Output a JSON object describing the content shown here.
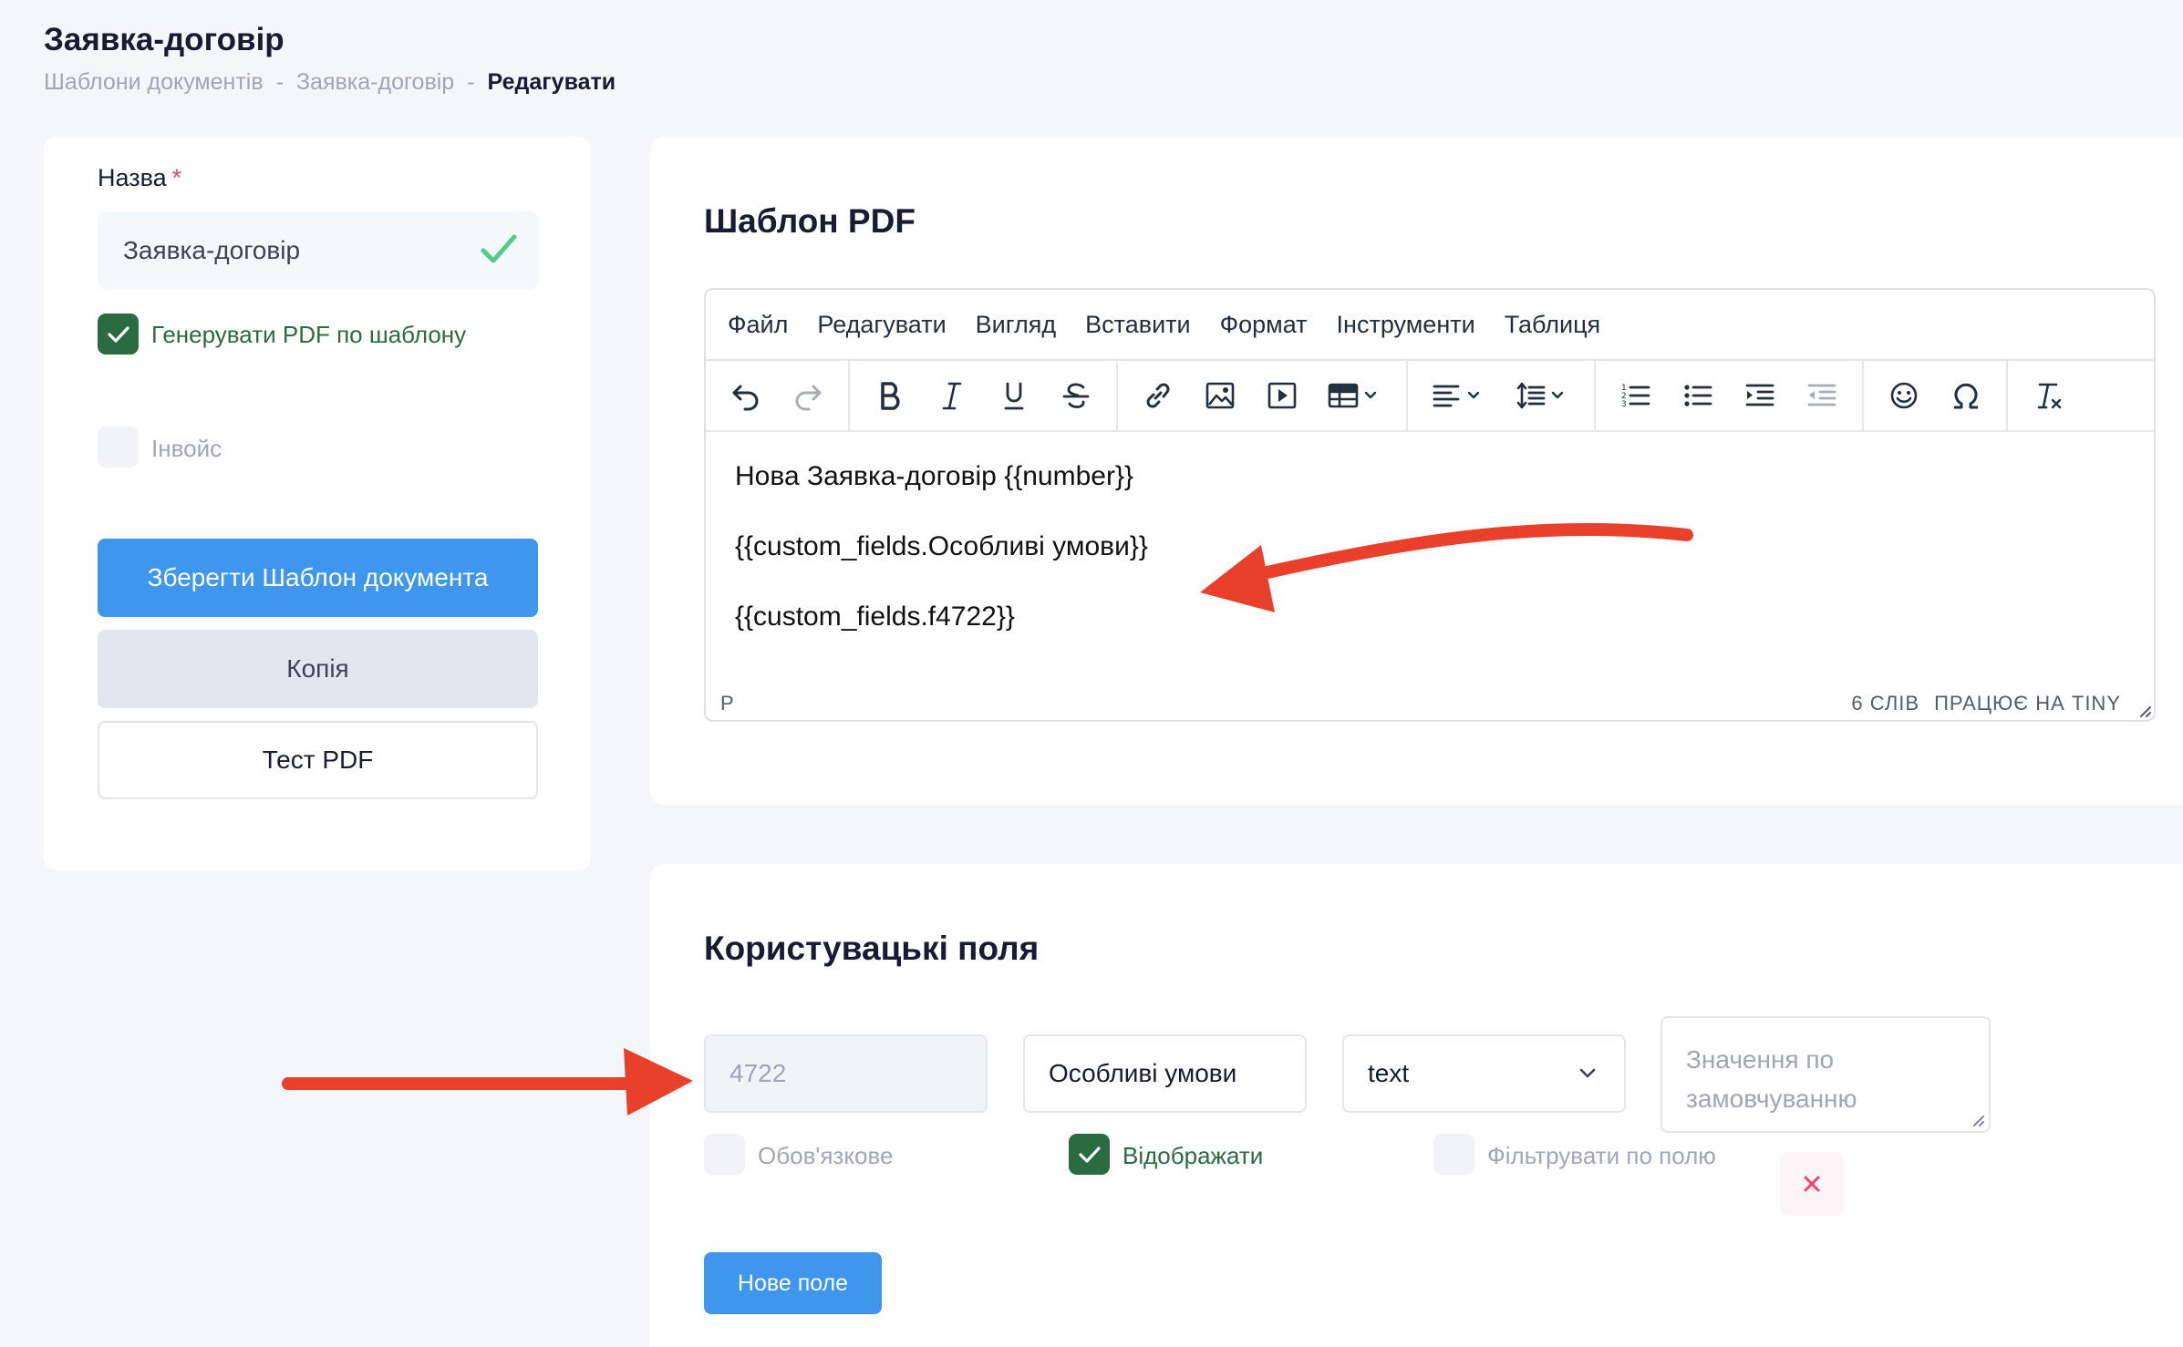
{
  "header": {
    "title": "Заявка-договір",
    "breadcrumb": [
      "Шаблони документів",
      "Заявка-договір",
      "Редагувати"
    ],
    "breadcrumb_sep": "-"
  },
  "left": {
    "name_label": "Назва",
    "required_mark": "*",
    "name_value": "Заявка-договір",
    "generate_pdf_label": "Генерувати PDF по шаблону",
    "generate_pdf_checked": true,
    "invoice_label": "Інвойс",
    "invoice_checked": false,
    "save_label": "Зберегти Шаблон документа",
    "copy_label": "Копія",
    "test_label": "Тест PDF"
  },
  "pdf": {
    "title": "Шаблон PDF",
    "menu": [
      "Файл",
      "Редагувати",
      "Вигляд",
      "Вставити",
      "Формат",
      "Інструменти",
      "Таблиця"
    ],
    "content": [
      "Нова Заявка-договір {{number}}",
      "{{custom_fields.Особливі умови}}",
      "{{custom_fields.f4722}}"
    ],
    "status_path": "P",
    "word_count": "6 СЛІВ",
    "powered": "ПРАЦЮЄ НА TINY"
  },
  "fields": {
    "title": "Користувацькі поля",
    "row": {
      "id_value": "4722",
      "name_value": "Особливі умови",
      "type_value": "text",
      "default_placeholder": "Значення по замовчуванню",
      "required_label": "Обов'язкове",
      "required_checked": false,
      "show_label": "Відображати",
      "show_checked": true,
      "filter_label": "Фільтрувати по полю",
      "filter_checked": false
    },
    "delete_glyph": "✕",
    "new_field_label": "Нове поле"
  },
  "colors": {
    "primary": "#3e97ec",
    "success": "#2a6b41",
    "danger": "#f1416c",
    "arrow": "#e8402a"
  }
}
